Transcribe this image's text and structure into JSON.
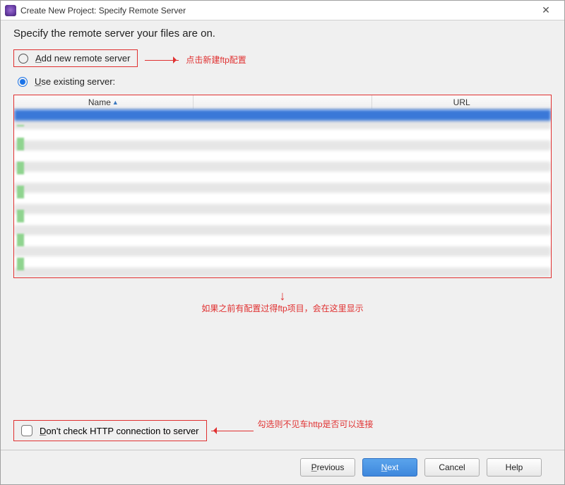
{
  "window": {
    "title": "Create New Project: Specify Remote Server"
  },
  "instruction": "Specify the remote server your files are on.",
  "options": {
    "add_new": {
      "mn": "A",
      "rest": "dd new remote server",
      "selected": false
    },
    "use_existing": {
      "mn": "U",
      "rest": "se existing server:",
      "selected": true
    }
  },
  "server_table": {
    "columns": {
      "name": "Name",
      "url": "URL"
    },
    "sort_column": "name",
    "sort_dir": "asc"
  },
  "checkbox": {
    "mn": "D",
    "rest": "on't check HTTP connection to server",
    "checked": false
  },
  "buttons": {
    "previous": {
      "mn": "P",
      "rest": "revious"
    },
    "next": {
      "mn": "N",
      "rest": "ext"
    },
    "cancel": {
      "label": "Cancel"
    },
    "help": {
      "label": "Help"
    }
  },
  "annotations": {
    "add_new": "点击新建ftp配置",
    "list_area": "如果之前有配置过得ftp项目，会在这里显示",
    "http_check": "勾选则不见车http是否可以连接"
  },
  "colors": {
    "annotation": "#e03030",
    "primary": "#3e87dc"
  }
}
